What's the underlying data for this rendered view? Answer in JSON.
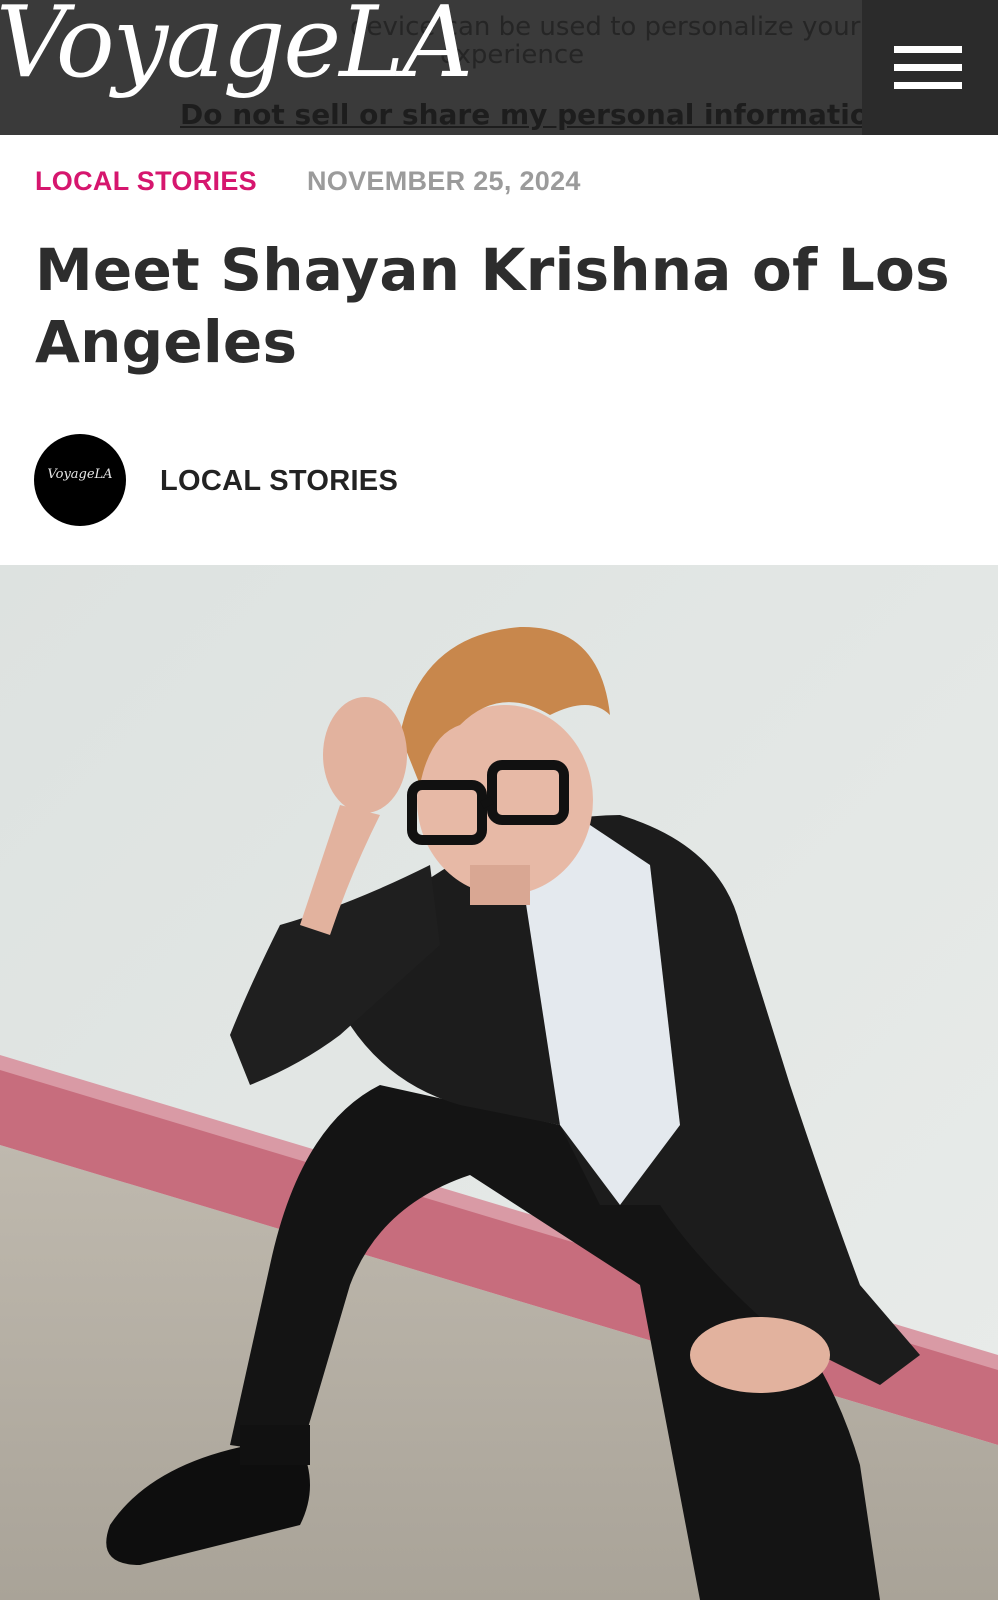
{
  "header": {
    "logo_text": "VoyageLA",
    "consent_line1": "device can be used to personalize your",
    "consent_line2": "experience",
    "consent_link": "Do not sell or share my personal information.",
    "menu_icon": "hamburger-menu-icon"
  },
  "article": {
    "category": "LOCAL STORIES",
    "date": "NOVEMBER 25, 2024",
    "title": "Meet Shayan Krishna of Los Angeles",
    "author_avatar_text": "VoyageLA",
    "author_name": "LOCAL STORIES"
  },
  "colors": {
    "accent": "#d6166e",
    "header_bg": "#3a3a3a",
    "title_text": "#2d2d2d",
    "date_text": "#9b9b9b"
  }
}
